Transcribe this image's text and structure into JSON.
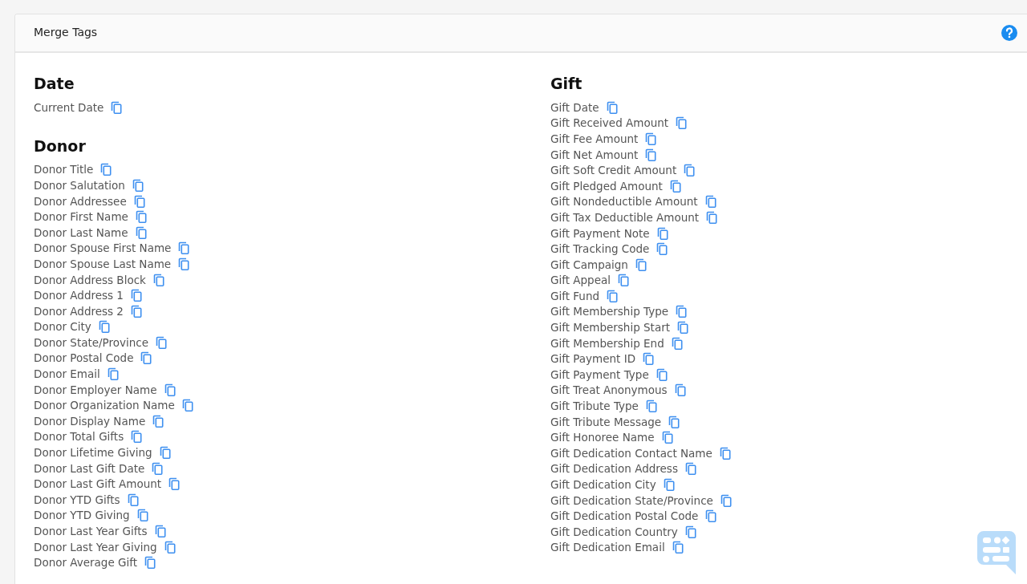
{
  "panel": {
    "title": "Merge Tags"
  },
  "columns": [
    {
      "groups": [
        {
          "heading": "Date",
          "tags": [
            "Current Date"
          ]
        },
        {
          "heading": "Donor",
          "tags": [
            "Donor Title",
            "Donor Salutation",
            "Donor Addressee",
            "Donor First Name",
            "Donor Last Name",
            "Donor Spouse First Name",
            "Donor Spouse Last Name",
            "Donor Address Block",
            "Donor Address 1",
            "Donor Address 2",
            "Donor City",
            "Donor State/Province",
            "Donor Postal Code",
            "Donor Email",
            "Donor Employer Name",
            "Donor Organization Name",
            "Donor Display Name",
            "Donor Total Gifts",
            "Donor Lifetime Giving",
            "Donor Last Gift Date",
            "Donor Last Gift Amount",
            "Donor YTD Gifts",
            "Donor YTD Giving",
            "Donor Last Year Gifts",
            "Donor Last Year Giving",
            "Donor Average Gift"
          ]
        }
      ]
    },
    {
      "groups": [
        {
          "heading": "Gift",
          "tags": [
            "Gift Date",
            "Gift Received Amount",
            "Gift Fee Amount",
            "Gift Net Amount",
            "Gift Soft Credit Amount",
            "Gift Pledged Amount",
            "Gift Nondeductible Amount",
            "Gift Tax Deductible Amount",
            "Gift Payment Note",
            "Gift Tracking Code",
            "Gift Campaign",
            "Gift Appeal",
            "Gift Fund",
            "Gift Membership Type",
            "Gift Membership Start",
            "Gift Membership End",
            "Gift Payment ID",
            "Gift Payment Type",
            "Gift Treat Anonymous",
            "Gift Tribute Type",
            "Gift Tribute Message",
            "Gift Honoree Name",
            "Gift Dedication Contact Name",
            "Gift Dedication Address",
            "Gift Dedication City",
            "Gift Dedication State/Province",
            "Gift Dedication Postal Code",
            "Gift Dedication Country",
            "Gift Dedication Email"
          ]
        }
      ]
    }
  ]
}
